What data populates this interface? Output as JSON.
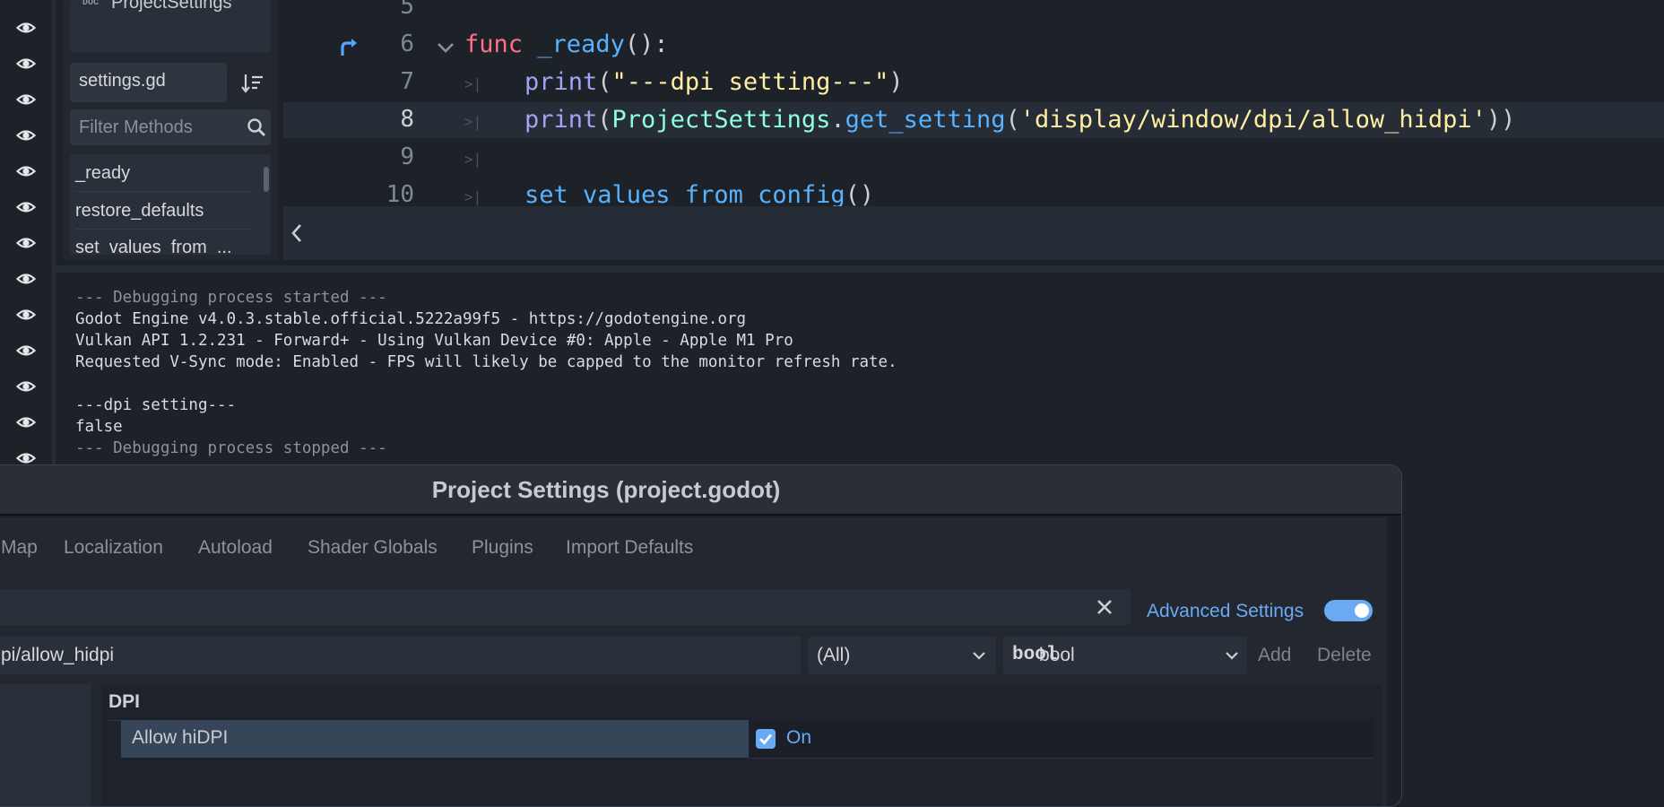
{
  "script_panel": {
    "doc_badge": "DOC",
    "doc_item": "ProjectSettings",
    "file_name": "settings.gd",
    "filter_placeholder": "Filter Methods",
    "methods": [
      "_ready",
      "restore_defaults",
      "set_values_from_..."
    ]
  },
  "editor": {
    "line_numbers": [
      "5",
      "6",
      "7",
      "8",
      "9",
      "10"
    ],
    "line6": {
      "kw": "func",
      "name": "_ready",
      "rest": "():"
    },
    "line7": {
      "fn": "print",
      "open": "(",
      "str": "\"---dpi setting---\"",
      "close": ")"
    },
    "line8": {
      "fn": "print",
      "open": "(",
      "type": "ProjectSettings",
      "dot": ".",
      "method": "get_setting",
      "open2": "(",
      "str": "'display/window/dpi/allow_hidpi'",
      "close": "))"
    },
    "line10": {
      "fn": "set_values_from_config",
      "rest": "()"
    },
    "tab_glyph": ">|"
  },
  "output": {
    "lines": [
      "--- Debugging process started ---",
      "Godot Engine v4.0.3.stable.official.5222a99f5 - https://godotengine.org",
      "Vulkan API 1.2.231 - Forward+ - Using Vulkan Device #0: Apple - Apple M1 Pro",
      "Requested V-Sync mode: Enabled - FPS will likely be capped to the monitor refresh rate.",
      "",
      "---dpi setting---",
      "false",
      "--- Debugging process stopped ---"
    ]
  },
  "dialog": {
    "title": "Project Settings (project.godot)",
    "tabs": [
      "Map",
      "Localization",
      "Autoload",
      "Shader Globals",
      "Plugins",
      "Import Defaults"
    ],
    "advanced_settings_label": "Advanced Settings",
    "advanced_settings_on": true,
    "property_path": "pi/allow_hidpi",
    "filter_select": "(All)",
    "type_icon": "bool",
    "type_select": "bool",
    "add_label": "Add",
    "delete_label": "Delete",
    "section": "DPI",
    "property_name": "Allow hiDPI",
    "property_checked": true,
    "property_value": "On"
  },
  "colors": {
    "accent": "#6aa9f4",
    "keyword": "#ff7085",
    "string": "#ffeda1",
    "type": "#8effda"
  }
}
